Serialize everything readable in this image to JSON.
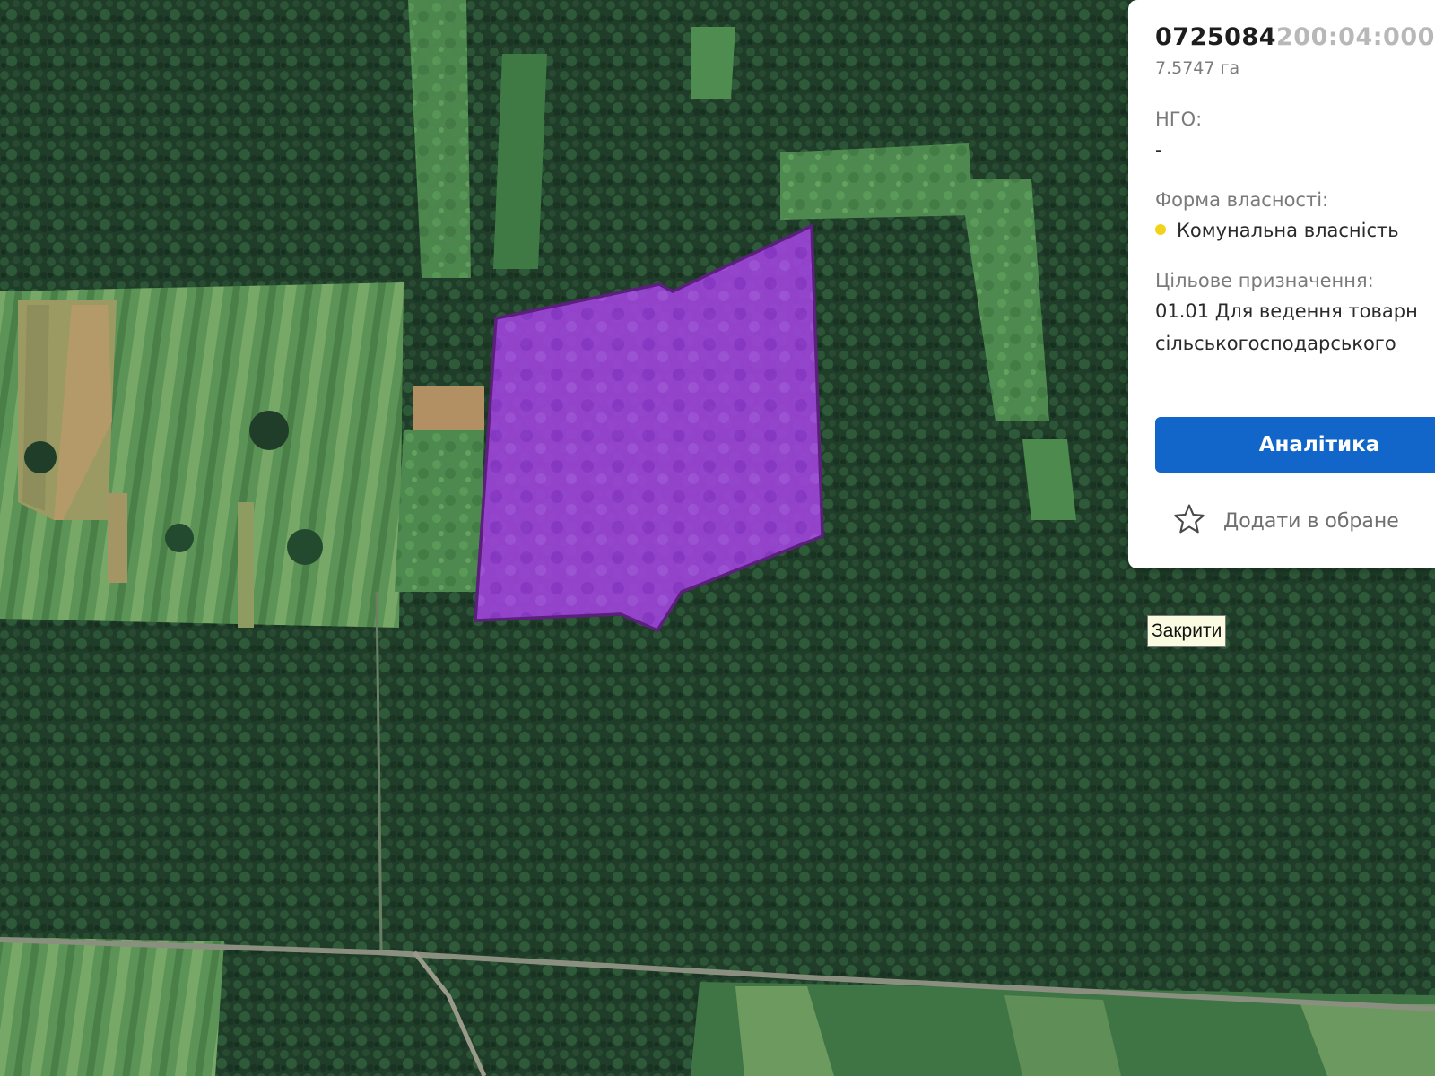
{
  "map": {
    "type": "satellite",
    "parcel_color": "#9b3ad6"
  },
  "popup": {
    "cadastral_number_visible": "0725084",
    "cadastral_number_faded": "200:04:000:",
    "area": "7.5747 га",
    "ngo_label": "НГО:",
    "ngo_value": "-",
    "ownership_label": "Форма власності:",
    "ownership_value": "Комунальна власність",
    "ownership_color": "#f2d21b",
    "purpose_label": "Цільове призначення:",
    "purpose_line1": "01.01 Для ведення товарн",
    "purpose_line2": "сільськогосподарського",
    "analytics_button": "Аналітика",
    "favorite_label": "Додати в обране"
  },
  "tooltip": {
    "text": "Закрити"
  }
}
